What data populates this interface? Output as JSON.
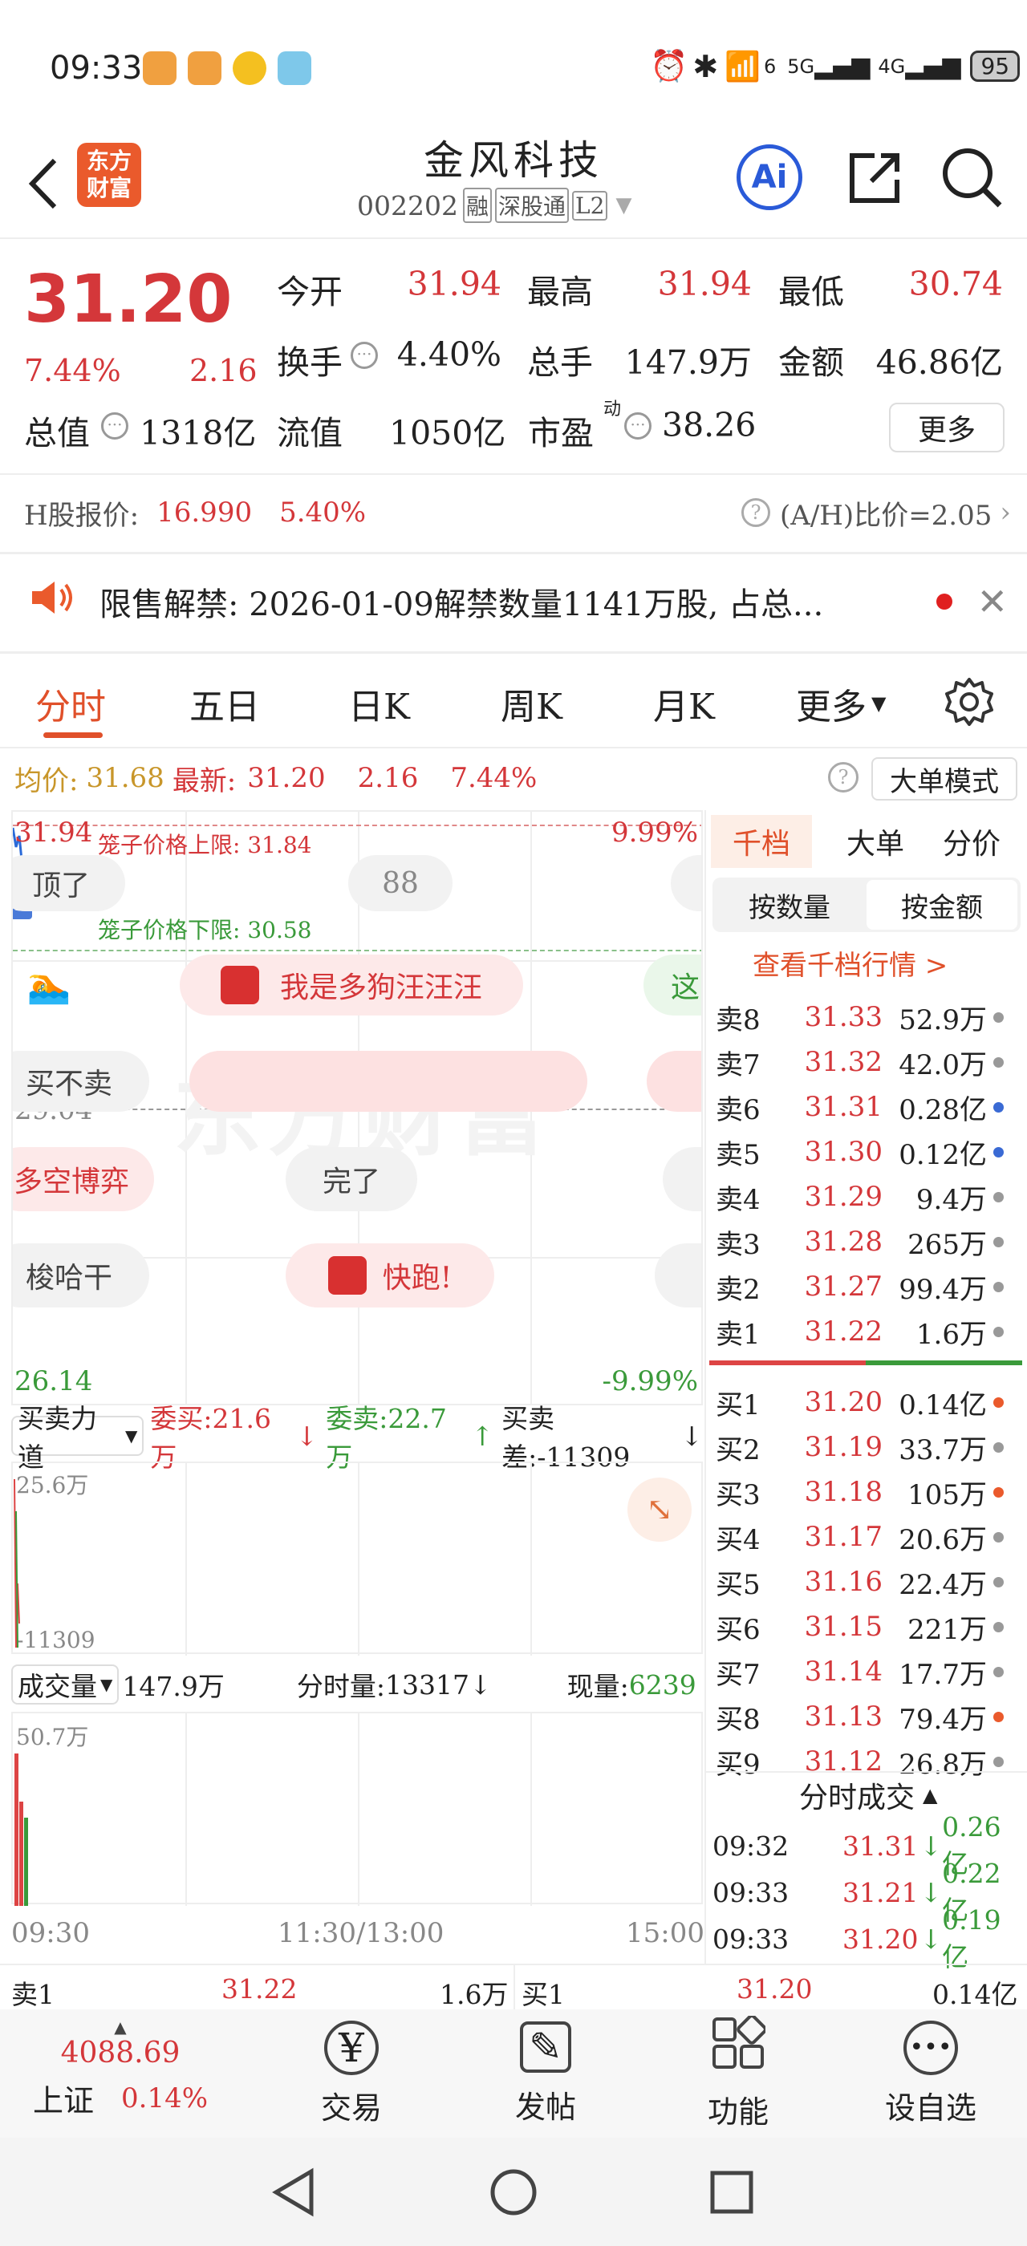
{
  "status": {
    "time": "09:33",
    "battery": "95",
    "sig1": "6",
    "sig2": "5G",
    "sig3": "4G"
  },
  "header": {
    "title": "金风科技",
    "code": "002202",
    "tags": [
      "融",
      "深股通",
      "L2"
    ],
    "brand_line1": "东方",
    "brand_line2": "财富",
    "ai": "Ai"
  },
  "quote": {
    "price": "31.20",
    "pct": "7.44%",
    "chg": "2.16",
    "rows": [
      [
        {
          "label": "今开",
          "value": "31.94",
          "c": "red"
        },
        {
          "label": "最高",
          "value": "31.94",
          "c": "red"
        },
        {
          "label": "最低",
          "value": "30.74",
          "c": "red"
        }
      ],
      [
        {
          "label": "换手",
          "value": "4.40%",
          "c": "dark"
        },
        {
          "label": "总手",
          "value": "147.9万",
          "c": "dark"
        },
        {
          "label": "金额",
          "value": "46.86亿",
          "c": "dark"
        }
      ],
      [
        {
          "label": "总值",
          "value": "1318亿",
          "c": "dark"
        },
        {
          "label": "流值",
          "value": "1050亿",
          "c": "dark"
        },
        {
          "label": "市盈",
          "value": "38.26",
          "c": "dark",
          "sup": "动"
        }
      ]
    ],
    "more": "更多"
  },
  "hshare": {
    "label": "H股报价:",
    "price": "16.990",
    "pct": "5.40%",
    "ah": "(A/H)比价=2.05"
  },
  "notice": {
    "text": "限售解禁: 2026-01-09解禁数量1141万股, 占总..."
  },
  "tabs": [
    "分时",
    "五日",
    "日K",
    "周K",
    "月K",
    "更多"
  ],
  "avgbar": {
    "avg_label": "均价:",
    "avg": "31.68",
    "new_label": "最新:",
    "new": "31.20",
    "chg": "2.16",
    "pct": "7.44%",
    "mode": "大单模式"
  },
  "chart": {
    "top": "31.94",
    "top_pct": "9.99%",
    "mid": "29.04",
    "bot": "26.14",
    "bot_pct": "-9.99%",
    "cage_up": "笼子价格上限: 31.84",
    "cage_down": "笼子价格下限: 30.58",
    "bullets": [
      "顶了",
      "88",
      "我是多狗汪汪汪",
      "这",
      "买不卖",
      "多空博弈",
      "完了",
      "梭哈干",
      "快跑!"
    ],
    "watermark": "东方财富"
  },
  "bs": {
    "sel": "买卖力道",
    "buy": "委买:21.6万",
    "sell": "委卖:22.7万",
    "diff": "买卖差:-11309",
    "top": "25.6万",
    "bot": "-11309"
  },
  "vol": {
    "sel": "成交量",
    "total": "147.9万",
    "fs_label": "分时量:",
    "fs": "13317",
    "now_label": "现量:",
    "now": "6239",
    "top": "50.7万",
    "times": [
      "09:30",
      "11:30/13:00",
      "15:00"
    ]
  },
  "ob": {
    "tabs": [
      "千档",
      "大单",
      "分价"
    ],
    "sub": [
      "按数量",
      "按金额"
    ],
    "link": "查看千档行情 >",
    "sells": [
      [
        "卖8",
        "31.33",
        "52.9万",
        "grey"
      ],
      [
        "卖7",
        "31.32",
        "42.0万",
        "grey"
      ],
      [
        "卖6",
        "31.31",
        "0.28亿",
        "blue"
      ],
      [
        "卖5",
        "31.30",
        "0.12亿",
        "blue"
      ],
      [
        "卖4",
        "31.29",
        "9.4万",
        "grey"
      ],
      [
        "卖3",
        "31.28",
        "265万",
        "grey"
      ],
      [
        "卖2",
        "31.27",
        "99.4万",
        "grey"
      ],
      [
        "卖1",
        "31.22",
        "1.6万",
        "grey"
      ]
    ],
    "buys": [
      [
        "买1",
        "31.20",
        "0.14亿",
        "orange"
      ],
      [
        "买2",
        "31.19",
        "33.7万",
        "grey"
      ],
      [
        "买3",
        "31.18",
        "105万",
        "orange"
      ],
      [
        "买4",
        "31.17",
        "20.6万",
        "grey"
      ],
      [
        "买5",
        "31.16",
        "22.4万",
        "grey"
      ],
      [
        "买6",
        "31.15",
        "221万",
        "grey"
      ],
      [
        "买7",
        "31.14",
        "17.7万",
        "grey"
      ],
      [
        "买8",
        "31.13",
        "79.4万",
        "orange"
      ],
      [
        "买9",
        "31.12",
        "26.8万",
        "grey"
      ]
    ]
  },
  "ticks": {
    "title": "分时成交",
    "rows": [
      [
        "09:32",
        "31.31",
        "0.26亿"
      ],
      [
        "09:33",
        "31.21",
        "0.22亿"
      ],
      [
        "09:33",
        "31.20",
        "0.19亿"
      ]
    ]
  },
  "bottom_quote": {
    "s_label": "卖1",
    "s_price": "31.22",
    "s_vol": "1.6万",
    "b_label": "买1",
    "b_price": "31.20",
    "b_vol": "0.14亿"
  },
  "nav": {
    "index_val": "4088.69",
    "index_name": "上证",
    "index_pct": "0.14%",
    "items": [
      "交易",
      "发帖",
      "功能",
      "设自选"
    ]
  }
}
